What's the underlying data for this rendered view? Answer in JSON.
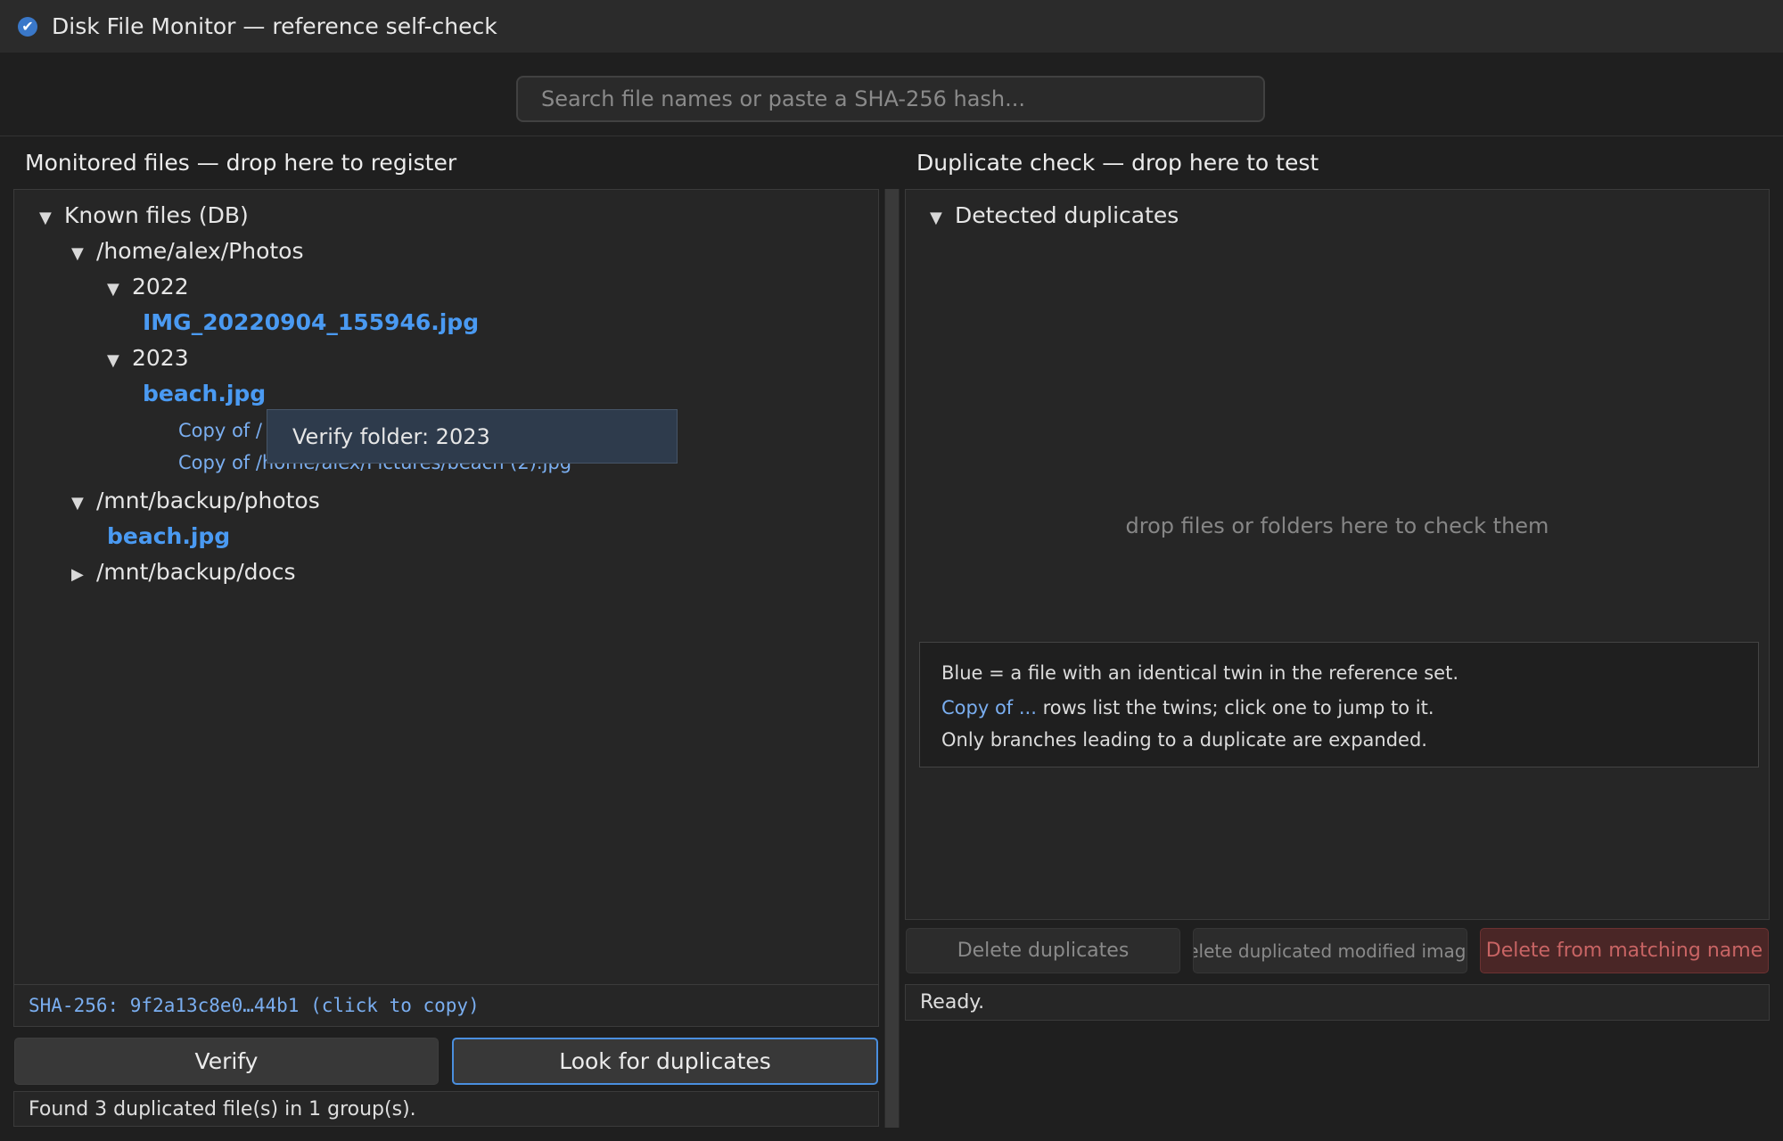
{
  "window": {
    "title": "Disk File Monitor — reference self-check",
    "icon": "check-icon"
  },
  "search": {
    "placeholder": "Search file names or paste a SHA-256 hash..."
  },
  "left_panel": {
    "header": "Monitored files — drop here to register",
    "tree": {
      "root": "Known files (DB)",
      "photos_dir": "/home/alex/Photos",
      "year_2022": "2022",
      "img_2022": "IMG_20220904_155946.jpg",
      "year_2023": "2023",
      "beach_2023": "beach.jpg",
      "copy_1": "Copy of /",
      "copy_2": "Copy of /home/alex/Pictures/beach (2).jpg",
      "backup_photos": "/mnt/backup/photos",
      "beach_backup": "beach.jpg",
      "backup_docs": "/mnt/backup/docs"
    },
    "context_menu": {
      "item": "Verify folder: 2023"
    },
    "hash_bar": "SHA-256: 9f2a13c8e0…44b1 (click to copy)",
    "verify_button": "Verify",
    "look_button": "Look for duplicates",
    "status": "Found 3 duplicated file(s) in 1 group(s)."
  },
  "right_panel": {
    "header": "Duplicate check — drop here to test",
    "tree_root": "Detected duplicates",
    "empty_hint": "drop files or folders here to check them",
    "legend": {
      "line1": "Blue = a file with an identical twin in the reference set.",
      "line2_link": "Copy of ...",
      "line2_rest": " rows list the twins; click one to jump to it.",
      "line3": "Only branches leading to a duplicate are expanded."
    },
    "buttons": {
      "delete_duplicates": "Delete duplicates",
      "delete_modified": "Delete duplicated modified images",
      "delete_matching": "Delete from matching name"
    },
    "status": "Ready."
  },
  "colors": {
    "accent": "#4a9af2",
    "copy_link": "#7aaef0",
    "danger": "#c86464"
  }
}
